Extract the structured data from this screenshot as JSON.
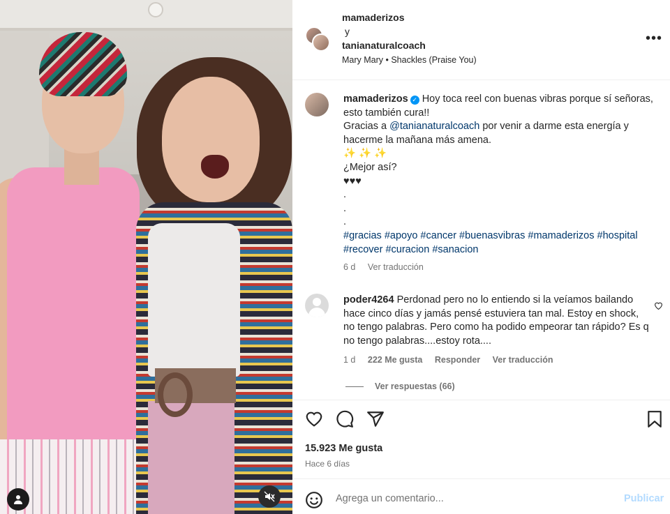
{
  "header": {
    "user1": "mamaderizos",
    "and": "y",
    "user2": "tanianaturalcoach",
    "song": "Mary Mary • Shackles (Praise You)",
    "more": "•••"
  },
  "caption": {
    "username": "mamaderizos",
    "text1": "Hoy toca reel con buenas vibras porque sí señoras, esto también cura!!",
    "text2_pre": "Gracias a ",
    "mention": "@tanianaturalcoach",
    "text2_post": " por venir a darme esta energía y hacerme la mañana más amena.",
    "sparkles": "✨ ✨ ✨",
    "text3": "¿Mejor así?",
    "hearts": "♥♥♥",
    "dot": ".",
    "hashtags": "#gracias #apoyo #cancer #buenasvibras #mamaderizos #hospital #recover #curacion #sanacion",
    "time": "6 d",
    "see_translation": "Ver traducción"
  },
  "comment": {
    "username": "poder4264",
    "text": "Perdonad pero no lo entiendo si la veíamos bailando hace cinco días y jamás pensé estuviera tan mal. Estoy en shock, no tengo palabras. Pero como ha podido empeorar tan rápido? Es q no tengo palabras....estoy rota....",
    "time": "1 d",
    "likes": "222 Me gusta",
    "reply": "Responder",
    "see_translation": "Ver traducción",
    "view_replies": "Ver respuestas (66)"
  },
  "actions": {
    "likes": "15.923 Me gusta",
    "time": "Hace 6 días"
  },
  "add_comment": {
    "placeholder": "Agrega un comentario...",
    "publish": "Publicar"
  },
  "colors": {
    "link_blue": "#00376b",
    "verified_blue": "#0095f6",
    "muted": "#737373",
    "publish_disabled": "#b3dbff"
  }
}
